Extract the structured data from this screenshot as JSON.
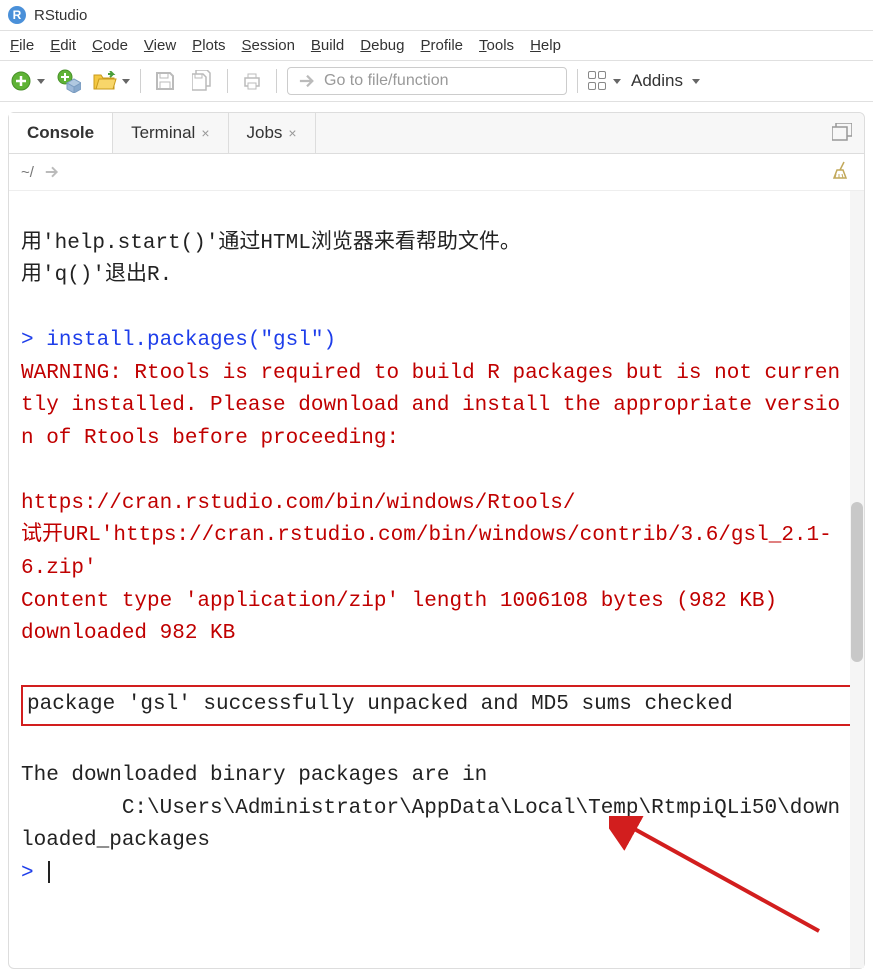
{
  "window": {
    "title": "RStudio"
  },
  "menu": {
    "file": "File",
    "edit": "Edit",
    "code": "Code",
    "view": "View",
    "plots": "Plots",
    "session": "Session",
    "build": "Build",
    "debug": "Debug",
    "profile": "Profile",
    "tools": "Tools",
    "help": "Help"
  },
  "toolbar": {
    "goto_placeholder": "Go to file/function",
    "addins": "Addins"
  },
  "tabs": {
    "console": "Console",
    "terminal": "Terminal",
    "jobs": "Jobs"
  },
  "subbar": {
    "path": "~/"
  },
  "console": {
    "l1": "用'help.start()'通过HTML浏览器来看帮助文件。",
    "l2": "用'q()'退出R.",
    "blank": "",
    "prompt1": "> ",
    "cmd1": "install.packages(\"gsl\")",
    "warn1": "WARNING: Rtools is required to build R packages but is not currently installed. Please download and install the appropriate version of Rtools before proceeding:",
    "url1": "https://cran.rstudio.com/bin/windows/Rtools/",
    "try1": "试开URL'https://cran.rstudio.com/bin/windows/contrib/3.6/gsl_2.1-6.zip'",
    "ct1": "Content type 'application/zip' length 1006108 bytes (982 KB)",
    "dl1": "downloaded 982 KB",
    "boxed": "package 'gsl' successfully unpacked and MD5 sums checked",
    "bin1": "The downloaded binary packages are in",
    "bin2": "        C:\\Users\\Administrator\\AppData\\Local\\Temp\\RtmpiQLi50\\downloaded_packages",
    "prompt2": "> "
  }
}
